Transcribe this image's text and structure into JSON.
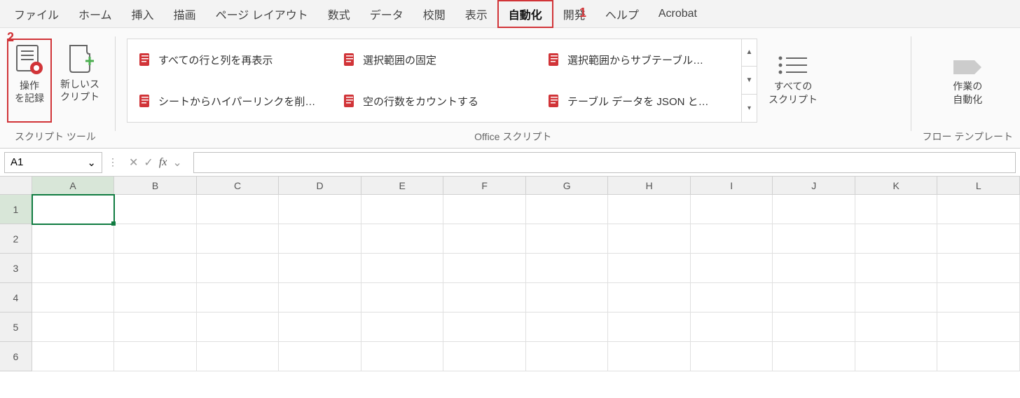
{
  "menubar": {
    "items": [
      "ファイル",
      "ホーム",
      "挿入",
      "描画",
      "ページ レイアウト",
      "数式",
      "データ",
      "校閲",
      "表示",
      "自動化",
      "開発",
      "ヘルプ",
      "Acrobat"
    ],
    "active_index": 9
  },
  "callouts": {
    "one": "1",
    "two": "2"
  },
  "ribbon": {
    "record": {
      "label_l1": "操作",
      "label_l2": "を記録"
    },
    "new_script": {
      "label_l1": "新しいス",
      "label_l2": "クリプト"
    },
    "group_tools_label": "スクリプト ツール",
    "gallery": {
      "items": [
        "すべての行と列を再表示",
        "選択範囲の固定",
        "選択範囲からサブテーブル…",
        "シートからハイパーリンクを削…",
        "空の行数をカウントする",
        "テーブル データを JSON と…"
      ]
    },
    "all_scripts": {
      "label_l1": "すべての",
      "label_l2": "スクリプト"
    },
    "group_office_label": "Office スクリプト",
    "automate": {
      "label_l1": "作業の",
      "label_l2": "自動化"
    },
    "group_flow_label": "フロー テンプレート"
  },
  "formula_bar": {
    "cell_ref": "A1",
    "formula": ""
  },
  "grid": {
    "columns": [
      "A",
      "B",
      "C",
      "D",
      "E",
      "F",
      "G",
      "H",
      "I",
      "J",
      "K",
      "L"
    ],
    "rows": [
      "1",
      "2",
      "3",
      "4",
      "5",
      "6"
    ],
    "selected": {
      "row": "1",
      "col": "A"
    }
  }
}
